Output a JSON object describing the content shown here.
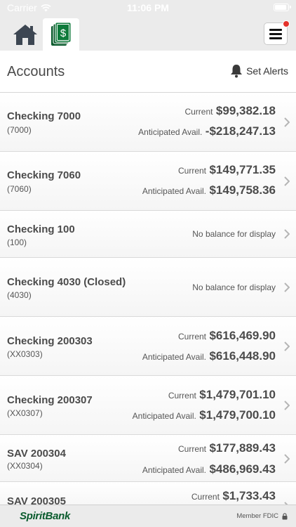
{
  "status_bar": {
    "carrier": "Carrier",
    "time": "11:06 PM"
  },
  "tabs": {
    "home_icon": "home-icon",
    "accounts_icon": "dollar-bills-icon"
  },
  "menu": {
    "icon": "hamburger-menu-icon",
    "has_notification": true
  },
  "header": {
    "title": "Accounts",
    "alerts_label": "Set Alerts"
  },
  "accounts": [
    {
      "name": "Checking 7000",
      "number": "(7000)",
      "current_label": "Current",
      "current": "$99,382.18",
      "avail_label": "Anticipated Avail.",
      "avail": "-$218,247.13"
    },
    {
      "name": "Checking 7060",
      "number": "(7060)",
      "current_label": "Current",
      "current": "$149,771.35",
      "avail_label": "Anticipated Avail.",
      "avail": "$149,758.36"
    },
    {
      "name": "Checking 100",
      "number": "(100)",
      "no_balance": "No balance for display"
    },
    {
      "name": "Checking 4030 (Closed)",
      "number": "(4030)",
      "no_balance": "No balance for display"
    },
    {
      "name": "Checking 200303",
      "number": "(XX0303)",
      "current_label": "Current",
      "current": "$616,469.90",
      "avail_label": "Anticipated Avail.",
      "avail": "$616,448.90"
    },
    {
      "name": "Checking 200307",
      "number": "(XX0307)",
      "current_label": "Current",
      "current": "$1,479,701.10",
      "avail_label": "Anticipated Avail.",
      "avail": "$1,479,700.10"
    },
    {
      "name": "SAV 200304",
      "number": "(XX0304)",
      "current_label": "Current",
      "current": "$177,889.43",
      "avail_label": "Anticipated Avail.",
      "avail": "$486,969.43"
    },
    {
      "name": "SAV 200305",
      "current_label": "Current",
      "current": "$1,733.43"
    }
  ],
  "footer": {
    "logo": "SpiritBank",
    "fdic": "Member FDIC"
  },
  "colors": {
    "brand_green": "#0b5c2e",
    "notification_red": "#e4322b",
    "chrome_gray": "#ebebeb"
  }
}
